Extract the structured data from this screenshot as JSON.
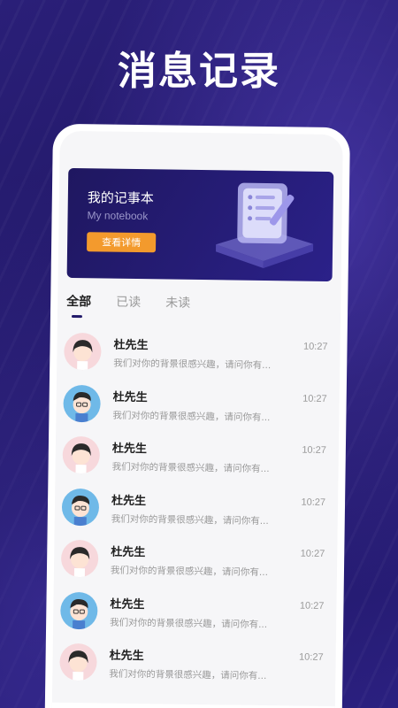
{
  "hero": {
    "title": "消息记录"
  },
  "banner": {
    "title": "我的记事本",
    "subtitle": "My notebook",
    "button_label": "查看详情"
  },
  "tabs": [
    {
      "label": "全部",
      "active": true
    },
    {
      "label": "已读",
      "active": false
    },
    {
      "label": "未读",
      "active": false
    }
  ],
  "messages": [
    {
      "avatar": "girl-avatar",
      "name": "杜先生",
      "preview": "我们对你的背景很感兴趣，请问你有...",
      "time": "10:27"
    },
    {
      "avatar": "boy-avatar",
      "name": "杜先生",
      "preview": "我们对你的背景很感兴趣，请问你有...",
      "time": "10:27"
    },
    {
      "avatar": "girl-avatar",
      "name": "杜先生",
      "preview": "我们对你的背景很感兴趣，请问你有...",
      "time": "10:27"
    },
    {
      "avatar": "boy-avatar",
      "name": "杜先生",
      "preview": "我们对你的背景很感兴趣，请问你有...",
      "time": "10:27"
    },
    {
      "avatar": "girl-avatar",
      "name": "杜先生",
      "preview": "我们对你的背景很感兴趣，请问你有...",
      "time": "10:27"
    },
    {
      "avatar": "boy-avatar",
      "name": "杜先生",
      "preview": "我们对你的背景很感兴趣，请问你有...",
      "time": "10:27"
    },
    {
      "avatar": "girl-avatar",
      "name": "杜先生",
      "preview": "我们对你的背景很感兴趣，请问你有...",
      "time": "10:27"
    }
  ],
  "bottom_nav": {
    "icons": [
      "home-icon",
      "notes-icon",
      "profile-icon"
    ]
  },
  "colors": {
    "background": "#241a6b",
    "accent": "#f39a2d",
    "banner": "#1f1760"
  }
}
